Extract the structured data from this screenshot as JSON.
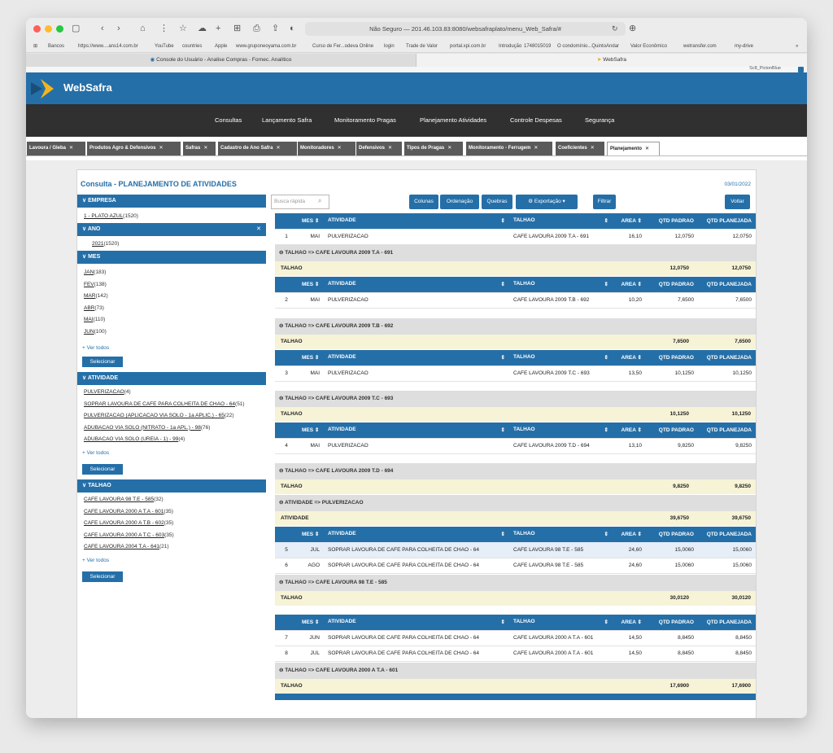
{
  "browser": {
    "url_text": "Não Seguro — 201.46.103.83:8080/websafraplato/menu_Web_Safra/#",
    "bookmarks": [
      "Bancos",
      "https://www....ans14.com.br",
      "YouTube",
      "countries",
      "Apple",
      "www.gruponeoyama.com.br",
      "Curso de Fer...odeva Online",
      "login",
      "Trade de Valor",
      "portal.xpi.com.br",
      "Introdução",
      "1748015019",
      "O condomínio...QuintoAndar",
      "Valor Econômico",
      "wetransfer.com",
      "my-drive"
    ],
    "tab1": "Console do Usuário - Analise Compras - Fornec. Analítico",
    "tab2": "WebSafra",
    "env": "Sc8_PictonBlue"
  },
  "app": {
    "brand": "WebSafra"
  },
  "menu": [
    "Consultas",
    "Lançamento Safra",
    "Monitoramento Pragas",
    "Planejamento Atividades",
    "Controle Despesas",
    "Segurança"
  ],
  "screen_tabs": [
    "Lavoura / Gleba",
    "Produtos Agro & Defensivos",
    "Safras",
    "Cadastro de Ano Safra",
    "Monitoradores",
    "Defensivos",
    "Tipos de Pragas",
    "Monitoramento - Ferrugem",
    "Coeficientes",
    "Planejamento"
  ],
  "page": {
    "title": "Consulta - PLANEJAMENTO DE ATIVIDADES",
    "date": "03/01/2022"
  },
  "filters": {
    "empresa": {
      "title": "EMPRESA",
      "items": [
        [
          "1 - PLATO AZUL",
          "(1520)"
        ]
      ]
    },
    "ano": {
      "title": "ANO",
      "items": [
        [
          "2021",
          "(1520)"
        ]
      ]
    },
    "mes": {
      "title": "MES",
      "items": [
        [
          "JAN",
          "(183)"
        ],
        [
          "FEV",
          "(138)"
        ],
        [
          "MAR",
          "(142)"
        ],
        [
          "ABR",
          "(73)"
        ],
        [
          "MAI",
          "(110)"
        ],
        [
          "JUN",
          "(100)"
        ]
      ]
    },
    "atividade": {
      "title": "ATIVIDADE",
      "items": [
        [
          "PULVERIZACAO",
          "(4)"
        ],
        [
          "SOPRAR LAVOURA DE CAFE PARA COLHEITA DE CHAO - 64",
          "(51)"
        ],
        [
          "PULVERIZACAO (APLICACAO VIA SOLO - 1a APLIC.) - 65",
          "(22)"
        ],
        [
          "ADUBACAO VIA SOLO (NITRATO - 1a APL.) - 98",
          "(76)"
        ],
        [
          "ADUBACAO VIA SOLO (UREIA - 1) - 99",
          "(4)"
        ]
      ]
    },
    "talhao": {
      "title": "TALHAO",
      "items": [
        [
          "CAFE LAVOURA 98 T.E - 585",
          "(32)"
        ],
        [
          "CAFE LAVOURA 2000 A T.A - 601",
          "(35)"
        ],
        [
          "CAFE LAVOURA 2000 A T.B - 602",
          "(35)"
        ],
        [
          "CAFE LAVOURA 2000 A T.C - 603",
          "(35)"
        ],
        [
          "CAFE LAVOURA 2004 T.A - 641",
          "(21)"
        ]
      ]
    },
    "ver_todos": "+ Ver todos",
    "selecionar": "Selecionar"
  },
  "toolbar": {
    "search_placeholder": "Busca rápida",
    "colunas": "Colunas",
    "ordenacao": "Ordenação",
    "quebras": "Quebras",
    "exportacao": "Exportação",
    "filtrar": "Filtrar",
    "voltar": "Voltar"
  },
  "columns": [
    "MES",
    "ATIVIDADE",
    "TALHAO",
    "AREA",
    "QTD PADRAO",
    "QTD PLANEJADA"
  ],
  "rows": [
    [
      "1",
      "MAI",
      "PULVERIZACAO",
      "CAFE LAVOURA 2009 T.A - 691",
      "16,10",
      "12,0750",
      "12,0750"
    ],
    [
      "2",
      "MAI",
      "PULVERIZACAO",
      "CAFE LAVOURA 2009 T.B - 692",
      "10,20",
      "7,6500",
      "7,6500"
    ],
    [
      "3",
      "MAI",
      "PULVERIZACAO",
      "CAFE LAVOURA 2009 T.C - 693",
      "13,50",
      "10,1250",
      "10,1250"
    ],
    [
      "4",
      "MAI",
      "PULVERIZACAO",
      "CAFE LAVOURA 2009 T.D - 694",
      "13,10",
      "9,8250",
      "9,8250"
    ],
    [
      "5",
      "JUL",
      "SOPRAR LAVOURA DE CAFE PARA COLHEITA DE CHAO - 64",
      "CAFE LAVOURA 98 T.E - 585",
      "24,60",
      "15,0060",
      "15,0060"
    ],
    [
      "6",
      "AGO",
      "SOPRAR LAVOURA DE CAFE PARA COLHEITA DE CHAO - 64",
      "CAFE LAVOURA 98 T.E - 585",
      "24,60",
      "15,0060",
      "15,0060"
    ],
    [
      "7",
      "JUN",
      "SOPRAR LAVOURA DE CAFE PARA COLHEITA DE CHAO - 64",
      "CAFE LAVOURA 2000 A T.A - 601",
      "14,50",
      "8,8450",
      "8,8450"
    ],
    [
      "8",
      "JUL",
      "SOPRAR LAVOURA DE CAFE PARA COLHEITA DE CHAO - 64",
      "CAFE LAVOURA 2000 A T.A - 601",
      "14,50",
      "8,8450",
      "8,8450"
    ]
  ],
  "groups": [
    "⊖ TALHAO => CAFE LAVOURA 2009 T.A - 691",
    "⊖ TALHAO => CAFE LAVOURA 2009 T.B - 692",
    "⊖ TALHAO => CAFE LAVOURA 2009 T.C - 693",
    "⊖ TALHAO => CAFE LAVOURA 2009 T.D - 694",
    "⊖ ATIVIDADE => PULVERIZACAO",
    "⊖ TALHAO => CAFE LAVOURA 98 T.E - 585",
    "⊖ TALHAO => CAFE LAVOURA 2000 A T.A - 601"
  ],
  "totals": [
    {
      "label": "TALHAO",
      "padrao": "12,0750",
      "planejada": "12,0750"
    },
    {
      "label": "TALHAO",
      "padrao": "7,6500",
      "planejada": "7,6500"
    },
    {
      "label": "TALHAO",
      "padrao": "10,1250",
      "planejada": "10,1250"
    },
    {
      "label": "TALHAO",
      "padrao": "9,8250",
      "planejada": "9,8250"
    },
    {
      "label": "ATIVIDADE",
      "padrao": "39,6750",
      "planejada": "39,6750"
    },
    {
      "label": "TALHAO",
      "padrao": "30,0120",
      "planejada": "30,0120"
    },
    {
      "label": "TALHAO",
      "padrao": "17,6900",
      "planejada": "17,6900"
    }
  ],
  "colors": {
    "primary": "#256fa8",
    "menu_bg": "#303030",
    "total_bg": "#f7f3d7",
    "group_bg": "#dedede"
  }
}
